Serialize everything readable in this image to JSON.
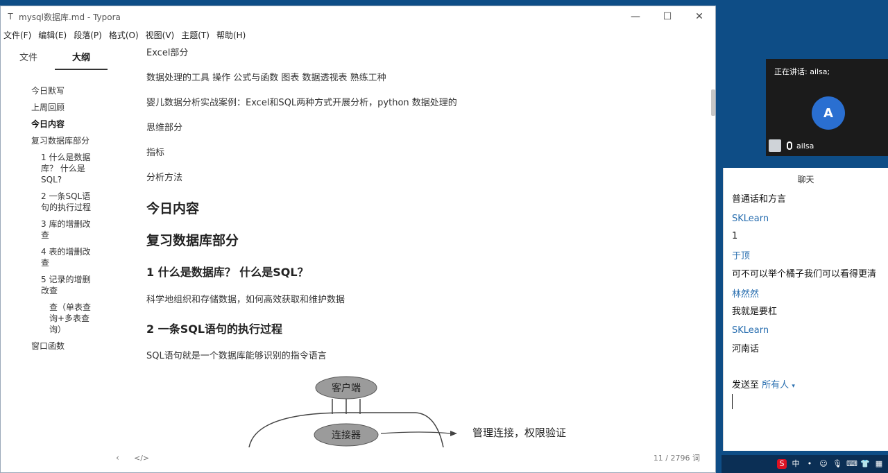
{
  "window": {
    "title": "mysql数据库.md - Typora",
    "controls": {
      "minimize": "—",
      "maximize": "☐",
      "close": "✕"
    }
  },
  "menu": [
    "文件(F)",
    "编辑(E)",
    "段落(P)",
    "格式(O)",
    "视图(V)",
    "主题(T)",
    "帮助(H)"
  ],
  "sidebar": {
    "tabs": [
      "文件",
      "大纲"
    ],
    "active_tab": "大纲",
    "outline": [
      "今日默写",
      "上周回顾",
      "今日内容",
      "复习数据库部分",
      "1 什么是数据",
      "库？ 什么是",
      "SQL?",
      "2 一条SQL语",
      "句的执行过程",
      "3 库的增删改",
      "查",
      "4 表的增删改",
      "查",
      "5 记录的增删",
      "改查",
      "查（单表查",
      "询+多表查",
      "询）",
      "窗口函数"
    ]
  },
  "doc": {
    "p1": "Excel部分",
    "p2": "数据处理的工具 操作 公式与函数 图表  数据透视表 熟练工种",
    "p3": "婴儿数据分析实战案例：Excel和SQL两种方式开展分析，python 数据处理的",
    "p4": "思维部分",
    "p5": "指标",
    "p6": "分析方法",
    "h1a": "今日内容",
    "h1b": "复习数据库部分",
    "h2a": "1 什么是数据库？ 什么是SQL？",
    "p7": "科学地组织和存储数据，如何高效获取和维护数据",
    "h2b": "2 一条SQL语句的执行过程",
    "p8": "SQL语句就是一个数据库能够识别的指令语言",
    "sketch": {
      "client": "客户端",
      "connector": "连接器",
      "note": "管理连接，权限验证"
    }
  },
  "status": {
    "back": "‹",
    "code": "</>",
    "words": "11 / 2796 词"
  },
  "meeting": {
    "speaking": "正在讲话: ailsa;",
    "avatar_letter": "A",
    "speaker_name": "ailsa"
  },
  "chat": {
    "title": "聊天",
    "lines": [
      {
        "type": "msg",
        "text": "普通话和方言"
      },
      {
        "type": "sender",
        "text": "SKLearn"
      },
      {
        "type": "msg",
        "text": "1"
      },
      {
        "type": "sender",
        "text": "于顶"
      },
      {
        "type": "msg",
        "text": "可不可以举个橘子我们可以看得更清"
      },
      {
        "type": "sender",
        "text": "林然然"
      },
      {
        "type": "msg",
        "text": "我就是要杠"
      },
      {
        "type": "sender",
        "text": "SKLearn"
      },
      {
        "type": "msg",
        "text": "河南话"
      }
    ],
    "send_label": "发送至",
    "send_target": "所有人"
  },
  "tray": {
    "ime": "中"
  }
}
